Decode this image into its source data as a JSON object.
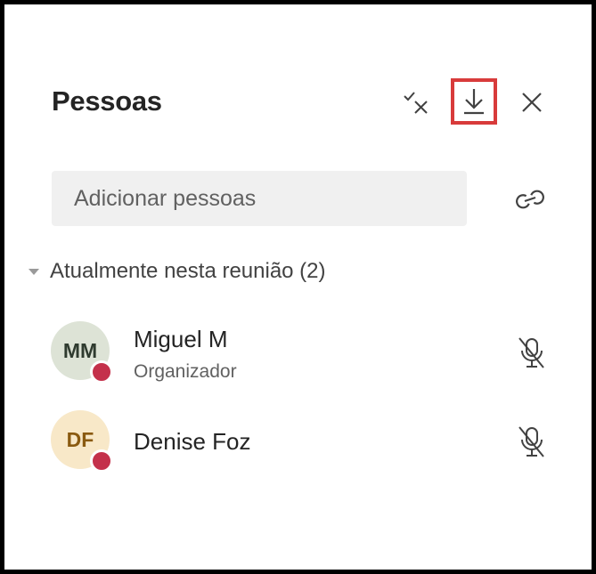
{
  "panel": {
    "title": "Pessoas",
    "header_icons": [
      "mute-all-icon",
      "download-icon",
      "close-icon"
    ],
    "highlight_color": "#d83b3b"
  },
  "search": {
    "placeholder": "Adicionar pessoas"
  },
  "section": {
    "label": "Atualmente nesta reunião (2)"
  },
  "participants": [
    {
      "initials": "MM",
      "name": "Miguel M",
      "role": "Organizador",
      "status_color": "#c4314b",
      "mic": "mic-off-icon"
    },
    {
      "initials": "DF",
      "name": "Denise Foz",
      "status_color": "#c4314b",
      "mic": "mic-off-icon"
    }
  ]
}
